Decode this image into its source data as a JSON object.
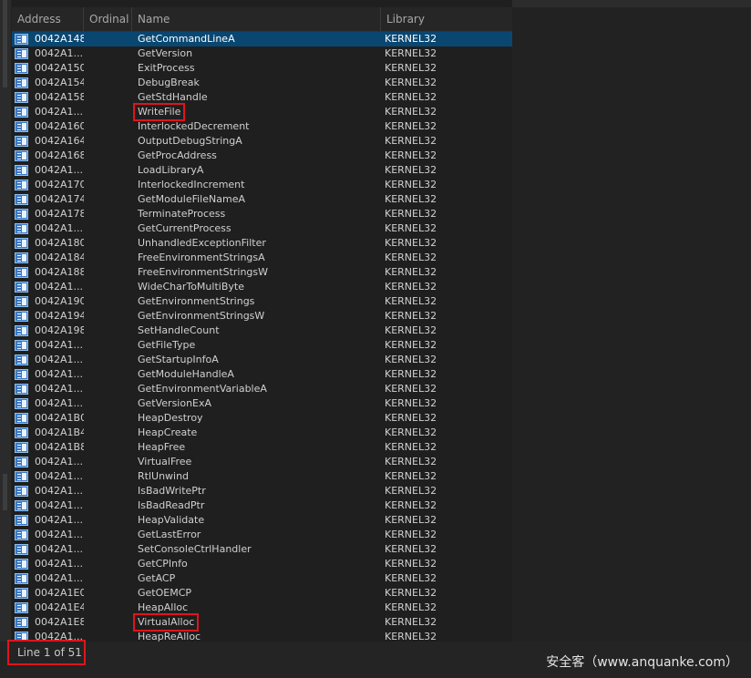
{
  "columns": {
    "address": "Address",
    "ordinal": "Ordinal",
    "name": "Name",
    "library": "Library"
  },
  "rows": [
    {
      "address": "0042A148",
      "ordinal": "",
      "name": "GetCommandLineA",
      "library": "KERNEL32",
      "selected": true
    },
    {
      "address": "0042A1...",
      "ordinal": "",
      "name": "GetVersion",
      "library": "KERNEL32"
    },
    {
      "address": "0042A150",
      "ordinal": "",
      "name": "ExitProcess",
      "library": "KERNEL32"
    },
    {
      "address": "0042A154",
      "ordinal": "",
      "name": "DebugBreak",
      "library": "KERNEL32"
    },
    {
      "address": "0042A158",
      "ordinal": "",
      "name": "GetStdHandle",
      "library": "KERNEL32"
    },
    {
      "address": "0042A1...",
      "ordinal": "",
      "name": "WriteFile",
      "library": "KERNEL32",
      "highlighted": true
    },
    {
      "address": "0042A160",
      "ordinal": "",
      "name": "InterlockedDecrement",
      "library": "KERNEL32"
    },
    {
      "address": "0042A164",
      "ordinal": "",
      "name": "OutputDebugStringA",
      "library": "KERNEL32"
    },
    {
      "address": "0042A168",
      "ordinal": "",
      "name": "GetProcAddress",
      "library": "KERNEL32"
    },
    {
      "address": "0042A1...",
      "ordinal": "",
      "name": "LoadLibraryA",
      "library": "KERNEL32"
    },
    {
      "address": "0042A170",
      "ordinal": "",
      "name": "InterlockedIncrement",
      "library": "KERNEL32"
    },
    {
      "address": "0042A174",
      "ordinal": "",
      "name": "GetModuleFileNameA",
      "library": "KERNEL32"
    },
    {
      "address": "0042A178",
      "ordinal": "",
      "name": "TerminateProcess",
      "library": "KERNEL32"
    },
    {
      "address": "0042A1...",
      "ordinal": "",
      "name": "GetCurrentProcess",
      "library": "KERNEL32"
    },
    {
      "address": "0042A180",
      "ordinal": "",
      "name": "UnhandledExceptionFilter",
      "library": "KERNEL32"
    },
    {
      "address": "0042A184",
      "ordinal": "",
      "name": "FreeEnvironmentStringsA",
      "library": "KERNEL32"
    },
    {
      "address": "0042A188",
      "ordinal": "",
      "name": "FreeEnvironmentStringsW",
      "library": "KERNEL32"
    },
    {
      "address": "0042A1...",
      "ordinal": "",
      "name": "WideCharToMultiByte",
      "library": "KERNEL32"
    },
    {
      "address": "0042A190",
      "ordinal": "",
      "name": "GetEnvironmentStrings",
      "library": "KERNEL32"
    },
    {
      "address": "0042A194",
      "ordinal": "",
      "name": "GetEnvironmentStringsW",
      "library": "KERNEL32"
    },
    {
      "address": "0042A198",
      "ordinal": "",
      "name": "SetHandleCount",
      "library": "KERNEL32"
    },
    {
      "address": "0042A1...",
      "ordinal": "",
      "name": "GetFileType",
      "library": "KERNEL32"
    },
    {
      "address": "0042A1...",
      "ordinal": "",
      "name": "GetStartupInfoA",
      "library": "KERNEL32"
    },
    {
      "address": "0042A1...",
      "ordinal": "",
      "name": "GetModuleHandleA",
      "library": "KERNEL32"
    },
    {
      "address": "0042A1...",
      "ordinal": "",
      "name": "GetEnvironmentVariableA",
      "library": "KERNEL32"
    },
    {
      "address": "0042A1...",
      "ordinal": "",
      "name": "GetVersionExA",
      "library": "KERNEL32"
    },
    {
      "address": "0042A1B0",
      "ordinal": "",
      "name": "HeapDestroy",
      "library": "KERNEL32"
    },
    {
      "address": "0042A1B4",
      "ordinal": "",
      "name": "HeapCreate",
      "library": "KERNEL32"
    },
    {
      "address": "0042A1B8",
      "ordinal": "",
      "name": "HeapFree",
      "library": "KERNEL32"
    },
    {
      "address": "0042A1...",
      "ordinal": "",
      "name": "VirtualFree",
      "library": "KERNEL32"
    },
    {
      "address": "0042A1...",
      "ordinal": "",
      "name": "RtlUnwind",
      "library": "KERNEL32"
    },
    {
      "address": "0042A1...",
      "ordinal": "",
      "name": "IsBadWritePtr",
      "library": "KERNEL32"
    },
    {
      "address": "0042A1...",
      "ordinal": "",
      "name": "IsBadReadPtr",
      "library": "KERNEL32"
    },
    {
      "address": "0042A1...",
      "ordinal": "",
      "name": "HeapValidate",
      "library": "KERNEL32"
    },
    {
      "address": "0042A1...",
      "ordinal": "",
      "name": "GetLastError",
      "library": "KERNEL32"
    },
    {
      "address": "0042A1...",
      "ordinal": "",
      "name": "SetConsoleCtrlHandler",
      "library": "KERNEL32"
    },
    {
      "address": "0042A1...",
      "ordinal": "",
      "name": "GetCPInfo",
      "library": "KERNEL32"
    },
    {
      "address": "0042A1...",
      "ordinal": "",
      "name": "GetACP",
      "library": "KERNEL32"
    },
    {
      "address": "0042A1E0",
      "ordinal": "",
      "name": "GetOEMCP",
      "library": "KERNEL32"
    },
    {
      "address": "0042A1E4",
      "ordinal": "",
      "name": "HeapAlloc",
      "library": "KERNEL32"
    },
    {
      "address": "0042A1E8",
      "ordinal": "",
      "name": "VirtualAlloc",
      "library": "KERNEL32",
      "highlighted": true
    },
    {
      "address": "0042A1...",
      "ordinal": "",
      "name": "HeapReAlloc",
      "library": "KERNEL32"
    }
  ],
  "status": {
    "line_info": "Line 1 of 51"
  },
  "watermark": "安全客（www.anquanke.com）",
  "colors": {
    "selection": "#094771",
    "highlight_box": "#e0141c",
    "background": "#1f1f1f"
  },
  "icons": {
    "row_icon": "import-function-icon"
  }
}
